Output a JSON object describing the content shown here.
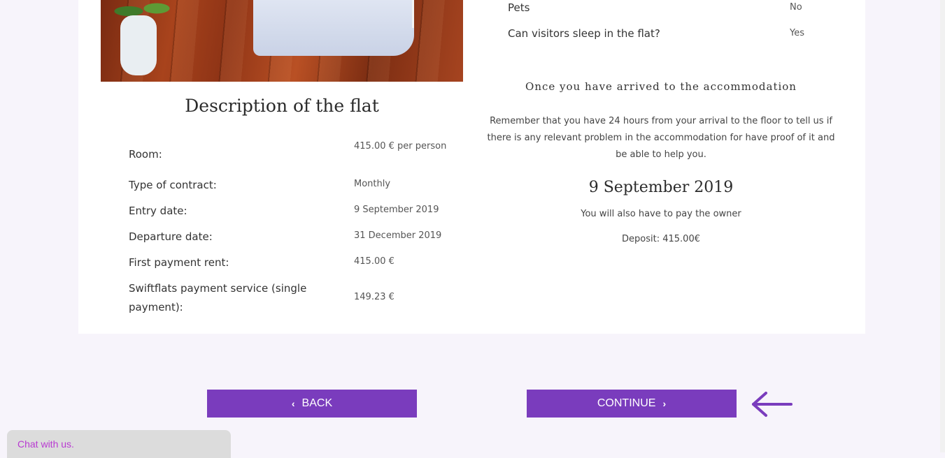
{
  "description": {
    "title": "Description of the flat",
    "rows": [
      {
        "label": "Room:",
        "value": "415.00 € per person"
      },
      {
        "label": "Type of contract:",
        "value": "Monthly"
      },
      {
        "label": "Entry date:",
        "value": "9 September 2019"
      },
      {
        "label": "Departure date:",
        "value": "31 December 2019"
      },
      {
        "label": "First payment rent:",
        "value": "415.00 €"
      },
      {
        "label": "Swiftflats payment service (single payment):",
        "value": "149.23 €"
      }
    ]
  },
  "rules": [
    {
      "label": "Pets",
      "value": "No"
    },
    {
      "label": "Can visitors sleep in the flat?",
      "value": "Yes"
    }
  ],
  "arrival": {
    "title": "Once you have arrived to the accommodation",
    "text": "Remember that you have 24 hours from your arrival to the floor to tell us if there is any relevant problem in the accommodation for have proof of it and be able to help you.",
    "date": "9 September 2019",
    "also": "You will also have to pay the owner",
    "deposit": "Deposit: 415.00€"
  },
  "buttons": {
    "back": "BACK",
    "continue": "CONTINUE"
  },
  "chat": {
    "label": "Chat with us."
  },
  "colors": {
    "accent": "#7a3cbd",
    "background": "#f7f4fb",
    "chat_text": "#b83ad1"
  }
}
